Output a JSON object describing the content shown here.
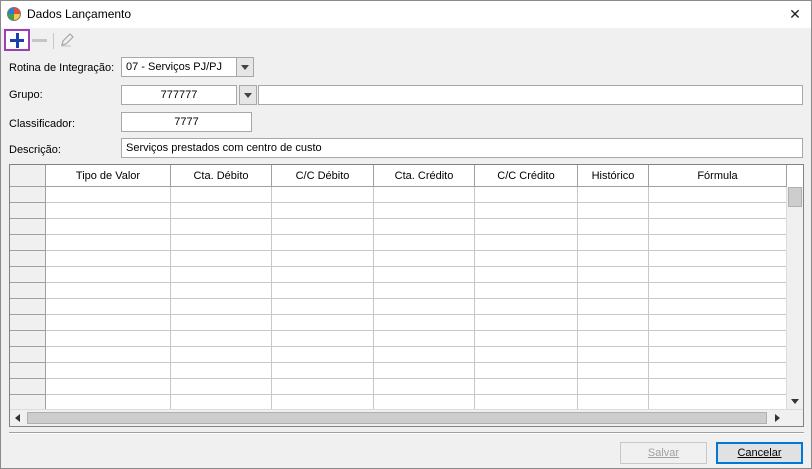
{
  "window": {
    "title": "Dados Lançamento",
    "close": "✕"
  },
  "form": {
    "rotina": {
      "label": "Rotina de Integração:",
      "value": "07 - Serviços PJ/PJ"
    },
    "grupo": {
      "label": "Grupo:",
      "value": "777777",
      "description": ""
    },
    "classificador": {
      "label": "Classificador:",
      "value": "7777"
    },
    "descricao": {
      "label": "Descrição:",
      "value": "Serviços prestados com centro de custo"
    }
  },
  "grid": {
    "columns": [
      "Tipo de Valor",
      "Cta. Débito",
      "C/C Débito",
      "Cta. Crédito",
      "C/C Crédito",
      "Histórico",
      "Fórmula"
    ]
  },
  "buttons": {
    "save": "Salvar",
    "cancel": "Cancelar"
  },
  "colors": {
    "accent_add": "#1c3fb0",
    "highlight_border": "#9b3fb5"
  }
}
